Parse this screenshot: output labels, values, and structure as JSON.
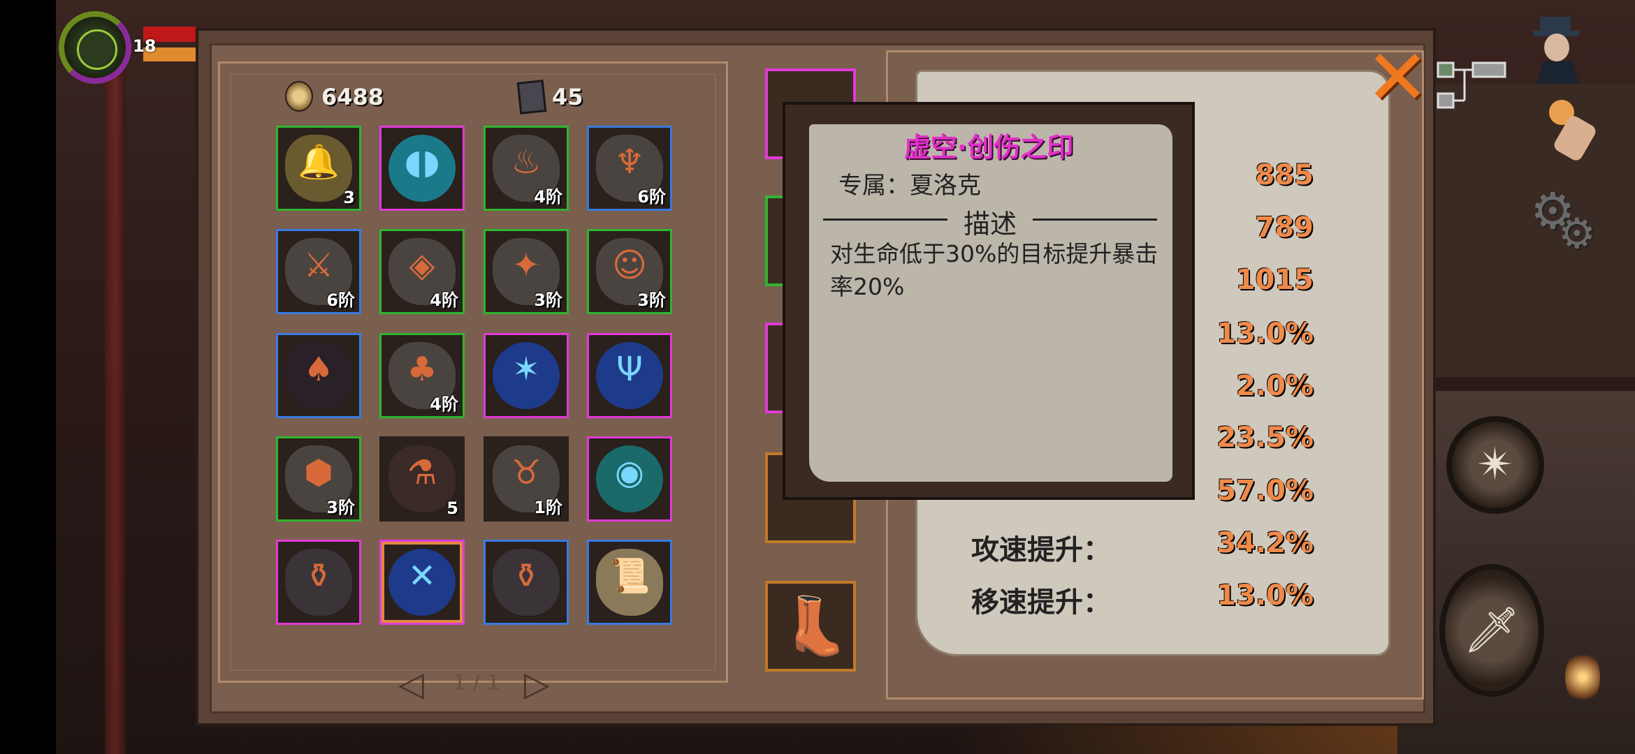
{
  "hud": {
    "player_level": "18",
    "health_color": "#c01818",
    "xp_color": "#e08a30"
  },
  "currency": {
    "gold": "6488",
    "books": "45"
  },
  "inventory": {
    "items": [
      {
        "name": "bell-bundle",
        "icon": "bell-icon",
        "glyph": "🔔",
        "count": "3",
        "rarity_color": "#2fb52f",
        "art_color": "#6a5a30",
        "orb": false
      },
      {
        "name": "void-orb",
        "icon": "void-rune-icon",
        "glyph": "◖◗",
        "count": "",
        "rarity_color": "#e23ad6",
        "art_color": "#1a7a8a",
        "orb": true
      },
      {
        "name": "fire-beast-rune",
        "icon": "fire-beast-rune-icon",
        "glyph": "♨",
        "count": "4阶",
        "rarity_color": "#2fb52f",
        "art_color": "#4a4440",
        "orb": false
      },
      {
        "name": "flame-rune",
        "icon": "flame-rune-icon",
        "glyph": "♆",
        "count": "6阶",
        "rarity_color": "#3a7be0",
        "art_color": "#4a4440",
        "orb": false
      },
      {
        "name": "sword-rune",
        "icon": "sword-rune-icon",
        "glyph": "⚔",
        "count": "6阶",
        "rarity_color": "#3a7be0",
        "art_color": "#4a4440",
        "orb": false
      },
      {
        "name": "leaf-rune",
        "icon": "leaf-rune-icon",
        "glyph": "◈",
        "count": "4阶",
        "rarity_color": "#2fb52f",
        "art_color": "#4a4440",
        "orb": false
      },
      {
        "name": "eagle-rune",
        "icon": "eagle-rune-icon",
        "glyph": "✦",
        "count": "3阶",
        "rarity_color": "#2fb52f",
        "art_color": "#4a4440",
        "orb": false
      },
      {
        "name": "cat-rune",
        "icon": "cat-rune-icon",
        "glyph": "☺",
        "count": "3阶",
        "rarity_color": "#2fb52f",
        "art_color": "#4a4440",
        "orb": false
      },
      {
        "name": "dark-eye-relic",
        "icon": "dark-eye-icon",
        "glyph": "♠",
        "count": "",
        "rarity_color": "#3a7be0",
        "art_color": "#2a2028",
        "orb": false
      },
      {
        "name": "tree-rune",
        "icon": "tree-rune-icon",
        "glyph": "♣",
        "count": "4阶",
        "rarity_color": "#2fb52f",
        "art_color": "#4a4440",
        "orb": false
      },
      {
        "name": "blue-burst-orb",
        "icon": "burst-orb-icon",
        "glyph": "✶",
        "count": "",
        "rarity_color": "#e23ad6",
        "art_color": "#1e3a8a",
        "orb": true
      },
      {
        "name": "trident-orb",
        "icon": "trident-orb-icon",
        "glyph": "Ψ",
        "count": "",
        "rarity_color": "#e23ad6",
        "art_color": "#1e3a8a",
        "orb": true
      },
      {
        "name": "shield-rune",
        "icon": "shield-rune-icon",
        "glyph": "⬢",
        "count": "3阶",
        "rarity_color": "#2fb52f",
        "art_color": "#4a4440",
        "orb": false
      },
      {
        "name": "red-potion",
        "icon": "potion-icon",
        "glyph": "⚗",
        "count": "5",
        "rarity_color": "#2a201c",
        "art_color": "#3a2a28",
        "orb": false
      },
      {
        "name": "horn-rune",
        "icon": "horn-rune-icon",
        "glyph": "♉",
        "count": "1阶",
        "rarity_color": "#2a201c",
        "art_color": "#4a4440",
        "orb": false
      },
      {
        "name": "eye-orb",
        "icon": "eye-orb-icon",
        "glyph": "◉",
        "count": "",
        "rarity_color": "#e23ad6",
        "art_color": "#1a6a6a",
        "orb": true
      },
      {
        "name": "purple-jar",
        "icon": "jar-icon",
        "glyph": "⚱",
        "count": "",
        "rarity_color": "#e23ad6",
        "art_color": "#3a3438",
        "orb": false
      },
      {
        "name": "void-wound-seal",
        "icon": "crossed-blades-orb-icon",
        "glyph": "✕",
        "count": "",
        "rarity_color": "#e23ad6",
        "art_color": "#1e3a8a",
        "orb": true
      },
      {
        "name": "black-jar",
        "icon": "dark-jar-icon",
        "glyph": "⚱",
        "count": "",
        "rarity_color": "#3a7be0",
        "art_color": "#3a3438",
        "orb": false
      },
      {
        "name": "map-scroll",
        "icon": "scroll-icon",
        "glyph": "📜",
        "count": "",
        "rarity_color": "#3a7be0",
        "art_color": "#8a7a5a",
        "orb": false
      }
    ],
    "page_indicator": "1 / 1"
  },
  "tooltip": {
    "title": "虚空·创伤之印",
    "exclusive": "专属：夏洛克",
    "section_heading": "描述",
    "description": "对生命低于30%的目标提升暴击率20%"
  },
  "stats": [
    {
      "label": "",
      "value": "885"
    },
    {
      "label": "",
      "value": "789"
    },
    {
      "label": "",
      "value": "1015"
    },
    {
      "label": "",
      "value": "13.0%"
    },
    {
      "label": "",
      "value": "2.0%"
    },
    {
      "label": "",
      "value": "23.5%"
    },
    {
      "label": "",
      "value": "57.0%"
    },
    {
      "label": "攻速提升：",
      "value": "34.2%"
    },
    {
      "label": "移速提升：",
      "value": "13.0%"
    }
  ]
}
